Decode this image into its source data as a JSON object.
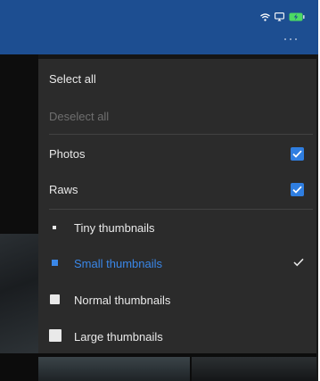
{
  "status_bar": {
    "icons": [
      "wifi-icon",
      "screen-mirror-icon",
      "battery-charging-icon"
    ],
    "battery_color": "#4cd964"
  },
  "topbar": {
    "color": "#1d4e91",
    "more_icon": "more-horizontal-icon"
  },
  "menu": {
    "select_all": "Select all",
    "deselect_all": "Deselect all",
    "filters": [
      {
        "label": "Photos",
        "checked": true
      },
      {
        "label": "Raws",
        "checked": true
      }
    ],
    "thumbnail_sizes": [
      {
        "label": "Tiny thumbnails",
        "selected": false
      },
      {
        "label": "Small thumbnails",
        "selected": true
      },
      {
        "label": "Normal thumbnails",
        "selected": false
      },
      {
        "label": "Large thumbnails",
        "selected": false
      }
    ],
    "accent": "#3a87e8"
  }
}
